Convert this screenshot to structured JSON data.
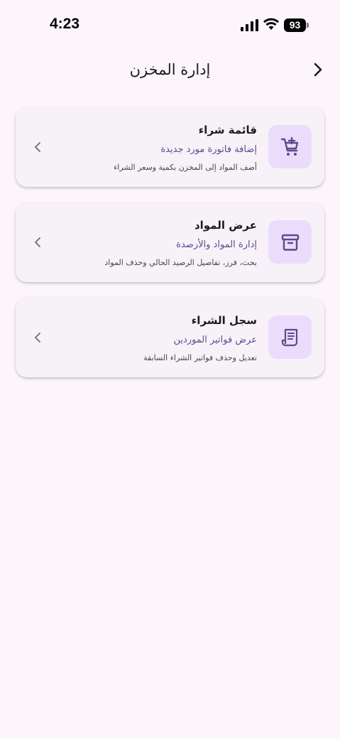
{
  "status_bar": {
    "time": "4:23",
    "battery": "93",
    "icons": [
      "signal-icon",
      "wifi-icon",
      "battery-icon"
    ]
  },
  "app_bar": {
    "title": "إدارة المخزن",
    "back_icon": "chevron-right-icon"
  },
  "cards": [
    {
      "title": "قائمة شراء",
      "subtitle": "إضافة فاتورة مورد جديدة",
      "description": "أضف المواد إلى المخزن بكمية وسعر الشراء",
      "icon": "add-to-cart-icon"
    },
    {
      "title": "عرض المواد",
      "subtitle": "إدارة المواد والأرصدة",
      "description": "بحث، فرز، تفاصيل الرصيد الحالي وحذف المواد",
      "icon": "archive-box-icon"
    },
    {
      "title": "سجل الشراء",
      "subtitle": "عرض فواتير الموردين",
      "description": "تعديل وحذف فواتير الشراء السابقة",
      "icon": "receipt-icon"
    }
  ],
  "colors": {
    "background": "#fcf6fc",
    "card": "#f7f2f8",
    "icon_box": "#ebdcfb",
    "icon": "#5b4b8a",
    "subtitle": "#5d4a8e"
  }
}
